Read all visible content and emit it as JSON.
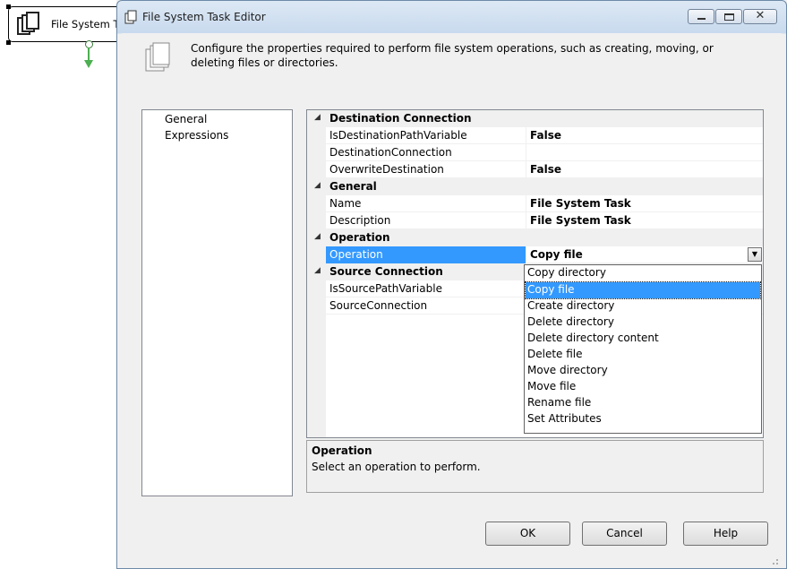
{
  "designer": {
    "task_label": "File System Task"
  },
  "window": {
    "title": "File System Task Editor",
    "close_glyph": "✕"
  },
  "header": {
    "description": "Configure the properties required to perform file system operations, such as creating, moving, or deleting files or directories."
  },
  "nav": {
    "items": [
      "General",
      "Expressions"
    ]
  },
  "properties": {
    "categories": [
      {
        "name": "Destination Connection",
        "rows": [
          {
            "name": "IsDestinationPathVariable",
            "value": "False"
          },
          {
            "name": "DestinationConnection",
            "value": ""
          },
          {
            "name": "OverwriteDestination",
            "value": "False"
          }
        ]
      },
      {
        "name": "General",
        "rows": [
          {
            "name": "Name",
            "value": "File System Task"
          },
          {
            "name": "Description",
            "value": "File System Task"
          }
        ]
      },
      {
        "name": "Operation",
        "rows": [
          {
            "name": "Operation",
            "value": "Copy file"
          }
        ]
      },
      {
        "name": "Source Connection",
        "rows": [
          {
            "name": "IsSourcePathVariable",
            "value": ""
          },
          {
            "name": "SourceConnection",
            "value": ""
          }
        ]
      }
    ],
    "collapse_glyph": "◢",
    "dropdown_glyph": "▼"
  },
  "dropdown": {
    "options": [
      "Copy directory",
      "Copy file",
      "Create directory",
      "Delete directory",
      "Delete directory content",
      "Delete file",
      "Move directory",
      "Move file",
      "Rename file",
      "Set Attributes"
    ],
    "selected": "Copy file"
  },
  "description_panel": {
    "title": "Operation",
    "text": "Select an operation to perform."
  },
  "buttons": {
    "ok": "OK",
    "cancel": "Cancel",
    "help": "Help"
  }
}
